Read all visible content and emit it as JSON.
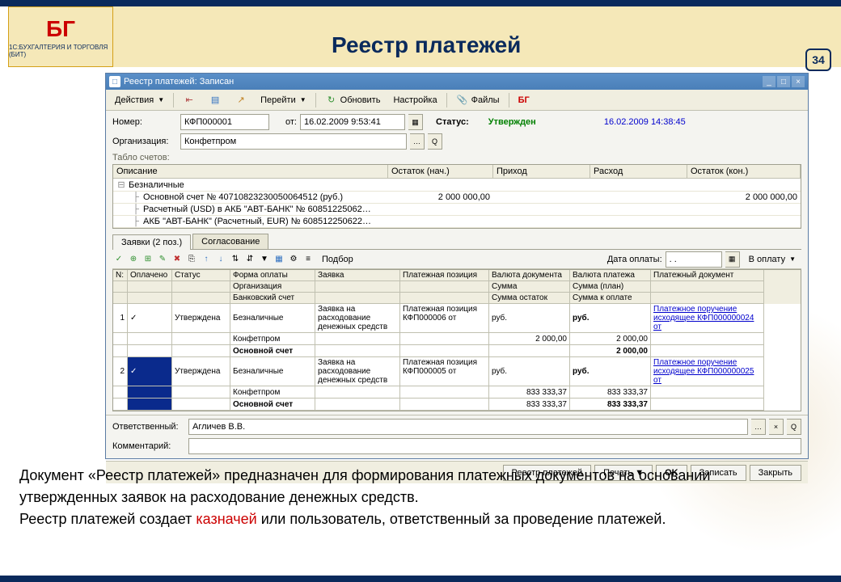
{
  "slide": {
    "title": "Реестр платежей",
    "number": "34",
    "logo_top": "БГ",
    "logo_bottom": "1С:БУХГАЛТЕРИЯ И ТОРГОВЛЯ (БИТ)"
  },
  "window": {
    "title": "Реестр платежей: Записан",
    "toolbar": {
      "actions": "Действия",
      "goto": "Перейти",
      "refresh": "Обновить",
      "settings": "Настройка",
      "files": "Файлы"
    },
    "fields": {
      "number_label": "Номер:",
      "number_value": "КФП000001",
      "from_label": "от:",
      "from_value": "16.02.2009  9:53:41",
      "status_label": "Статус:",
      "status_value": "Утвержден",
      "timestamp": "16.02.2009 14:38:45",
      "org_label": "Организация:",
      "org_value": "Конфетпром"
    },
    "accounts": {
      "title": "Табло счетов:",
      "headers": {
        "desc": "Описание",
        "bal_start": "Остаток (нач.)",
        "income": "Приход",
        "expense": "Расход",
        "bal_end": "Остаток (кон.)"
      },
      "rows": [
        {
          "indent": 0,
          "txt": "Безналичные",
          "v1": "",
          "v2": "",
          "v3": "",
          "v4": ""
        },
        {
          "indent": 1,
          "txt": "Основной счет № 40710823230050064512 (руб.)",
          "v1": "2 000 000,00",
          "v2": "",
          "v3": "",
          "v4": "2 000 000,00"
        },
        {
          "indent": 1,
          "txt": "Расчетный (USD) в АКБ \"АВТ-БАНК\" № 60851225062…",
          "v1": "",
          "v2": "",
          "v3": "",
          "v4": ""
        },
        {
          "indent": 1,
          "txt": "АКБ \"АВТ-БАНК\" (Расчетный, EUR) № 608512250622…",
          "v1": "",
          "v2": "",
          "v3": "",
          "v4": ""
        }
      ]
    },
    "tabs": {
      "t1": "Заявки (2 поз.)",
      "t2": "Согласование"
    },
    "subtoolbar": {
      "select": "Подбор",
      "paydate_lbl": "Дата оплаты:",
      "paydate_val": ". .",
      "inpay": "В оплату"
    },
    "grid": {
      "h1": {
        "n": "N:",
        "paid": "Оплачено",
        "stat": "Статус",
        "form": "Форма оплаты",
        "req": "Заявка",
        "pos": "Платежная позиция",
        "cur1": "Валюта документа",
        "cur2": "Валюта платежа",
        "doc": "Платежный документ"
      },
      "h2": {
        "form": "Организация",
        "cur1": "Сумма",
        "cur2": "Сумма (план)"
      },
      "h3": {
        "form": "Банковский счет",
        "cur1": "Сумма остаток",
        "cur2": "Сумма к оплате"
      },
      "rows": [
        {
          "n": "1",
          "paid": "✓",
          "stat": "Утверждена",
          "f1": "Безналичные",
          "f2": "Конфетпром",
          "f3": "Основной счет",
          "req": "Заявка на расходование денежных средств",
          "pos": "Платежная позиция КФП000006 от",
          "c1": "руб.",
          "c1a": "2 000,00",
          "c1b": "",
          "c2": "руб.",
          "c2a": "2 000,00",
          "c2b": "2 000,00",
          "doc": "Платежное поручение исходящее КФП000000024 от"
        },
        {
          "n": "2",
          "paid": "✓",
          "stat": "Утверждена",
          "f1": "Безналичные",
          "f2": "Конфетпром",
          "f3": "Основной счет",
          "req": "Заявка на расходование денежных средств",
          "pos": "Платежная позиция КФП000005 от",
          "c1": "руб.",
          "c1a": "833 333,37",
          "c1b": "833 333,37",
          "c2": "руб.",
          "c2a": "833 333,37",
          "c2b": "833 333,37",
          "doc": "Платежное поручение исходящее КФП000000025 от"
        }
      ]
    },
    "footer": {
      "resp_lbl": "Ответственный:",
      "resp_val": "Агличев В.В.",
      "comment_lbl": "Комментарий:",
      "comment_val": "",
      "btn_registry": "Реестр платежей",
      "btn_print": "Печать",
      "btn_ok": "OK",
      "btn_save": "Записать",
      "btn_close": "Закрыть"
    }
  },
  "description": {
    "p1a": "Документ «Реестр платежей» предназначен для формирования платежных документов на основании утвержденных заявок на расходование денежных средств.",
    "p2a": "Реестр платежей создает ",
    "p2b": "казначей",
    "p2c": " или пользователь, ответственный за проведение платежей."
  }
}
